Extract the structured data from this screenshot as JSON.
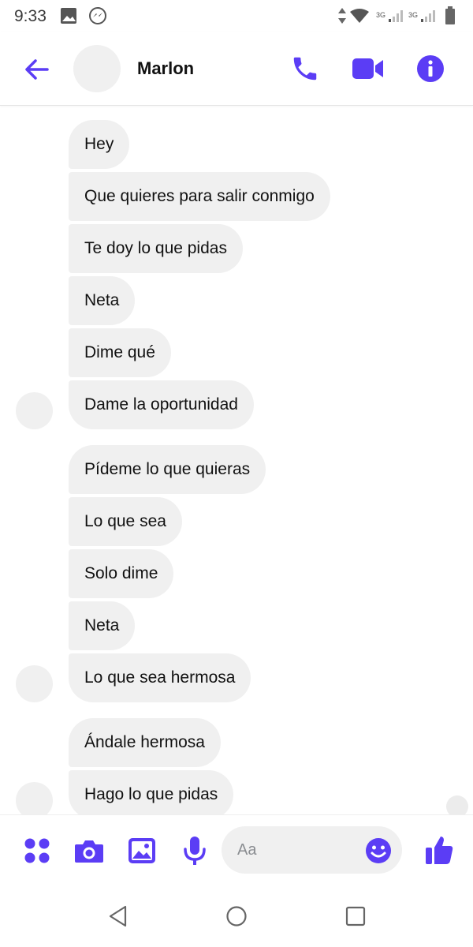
{
  "status_bar": {
    "time": "9:33"
  },
  "header": {
    "contact_name": "Marlon"
  },
  "messages": [
    "Hey",
    "Que quieres para salir conmigo",
    "Te doy lo que pidas",
    "Neta",
    "Dime qué",
    "Dame la oportunidad",
    "Pídeme lo que quieras",
    "Lo que sea",
    "Solo dime",
    "Neta",
    "Lo que sea hermosa",
    "Ándale hermosa",
    "Hago lo que pidas"
  ],
  "composer": {
    "placeholder": "Aa"
  },
  "colors": {
    "accent": "#5b3df5",
    "bubble": "#f0f0f0"
  }
}
